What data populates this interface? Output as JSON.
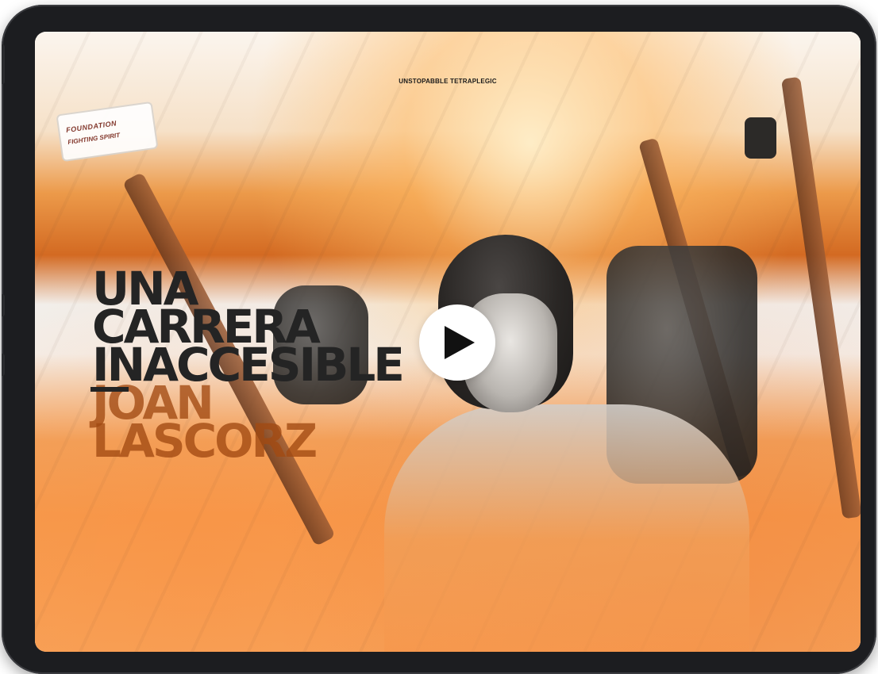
{
  "page": {
    "top_label": "UNSTOPABBLE TETRAPLEGIC"
  },
  "headline": {
    "line1": "UNA",
    "line2": "CARRERA",
    "line3": "INACCESIBLE",
    "line4": "JOAN",
    "line5": "LASCORZ"
  },
  "badge": {
    "title": "FOUNDATION",
    "subtitle": "FIGHTING SPIRIT"
  },
  "controls": {
    "play_icon": "play-icon"
  },
  "colors": {
    "headline_dark": "#242424",
    "headline_orange": "#a24a12",
    "accent_orange": "#f59a4d",
    "device_frame": "#1c1d20"
  }
}
